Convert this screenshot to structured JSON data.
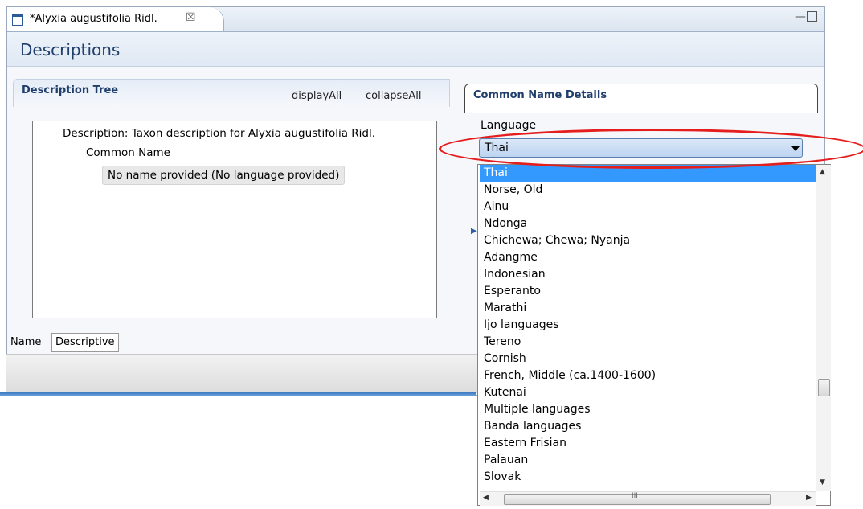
{
  "editor": {
    "tab_title": "*Alyxia augustifolia Ridl.",
    "tab_close": "☒",
    "header_title": "Descriptions"
  },
  "description_tree": {
    "title": "Description Tree",
    "display_all": "displayAll",
    "collapse_all": "collapseAll",
    "nodes": {
      "root": "Description: Taxon description for Alyxia augustifolia Ridl.",
      "child": "Common Name",
      "leaf": "No name provided (No language provided)"
    }
  },
  "bottom_tabs": [
    "Name",
    "Descriptive"
  ],
  "common_name_details": {
    "title": "Common Name Details",
    "language_label": "Language",
    "language_value": "Thai"
  },
  "language_options": [
    "Thai",
    "Norse, Old",
    "Ainu",
    "Ndonga",
    "Chichewa; Chewa; Nyanja",
    "Adangme",
    "Indonesian",
    "Esperanto",
    "Marathi",
    "Ijo languages",
    "Tereno",
    "Cornish",
    "French, Middle (ca.1400-1600)",
    "Kutenai",
    "Multiple languages",
    "Banda languages",
    "Eastern Frisian",
    "Palauan",
    "Slovak"
  ],
  "selected_option_index": 0,
  "hscroll_thumb_label": "III",
  "colors": {
    "selection": "#3399ff",
    "highlight_ellipse": "#e51d1d",
    "header_text": "#1f3e6c"
  }
}
